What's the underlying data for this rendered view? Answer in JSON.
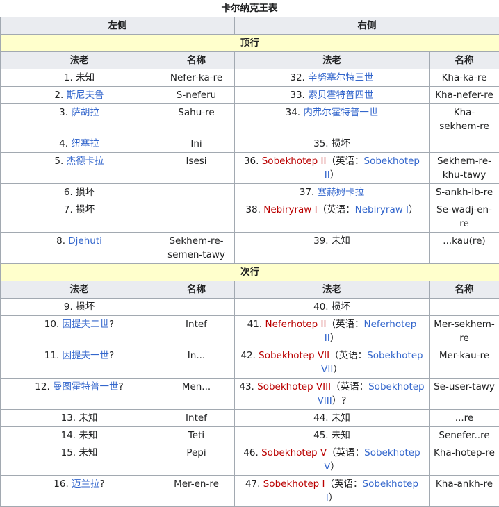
{
  "caption": "卡尔纳克王表",
  "sides": {
    "left": "左侧",
    "right": "右侧"
  },
  "col_headers": {
    "pharaoh": "法老",
    "name": "名称"
  },
  "sections": [
    {
      "title": "顶行",
      "rows": [
        {
          "left": [
            {
              "t": "1. 未知"
            }
          ],
          "left_name": "Nefer-ka-re",
          "right": [
            {
              "t": "32. "
            },
            {
              "t": "辛努塞尔特三世",
              "c": "lnk"
            }
          ],
          "right_name": "Kha-ka-re",
          "h": 25
        },
        {
          "left": [
            {
              "t": "2. "
            },
            {
              "t": "斯尼夫鲁",
              "c": "lnk"
            }
          ],
          "left_name": "S-neferu",
          "right": [
            {
              "t": "33. "
            },
            {
              "t": "索贝霍特普四世",
              "c": "lnk"
            }
          ],
          "right_name": "Kha-nefer-re",
          "h": 25
        },
        {
          "left": [
            {
              "t": "3. "
            },
            {
              "t": "萨胡拉",
              "c": "lnk"
            }
          ],
          "left_name": "Sahu-re",
          "right": [
            {
              "t": "34. "
            },
            {
              "t": "内弗尔霍特普一世",
              "c": "lnk"
            }
          ],
          "right_name": "Kha-sekhem-re",
          "h": 45
        },
        {
          "left": [
            {
              "t": "4. "
            },
            {
              "t": "纽塞拉",
              "c": "lnk"
            }
          ],
          "left_name": "Ini",
          "right": [
            {
              "t": "35. 损坏"
            }
          ],
          "right_name": "",
          "h": 25
        },
        {
          "left": [
            {
              "t": "5. "
            },
            {
              "t": "杰德卡拉",
              "c": "lnk"
            }
          ],
          "left_name": "Isesi",
          "right": [
            {
              "t": "36. "
            },
            {
              "t": "Sobekhotep II",
              "c": "red"
            },
            {
              "t": "（英语："
            },
            {
              "t": "Sobekhotep II",
              "c": "lnk"
            },
            {
              "t": "）"
            }
          ],
          "right_name": "Sekhem-re-khu-tawy",
          "h": 45
        },
        {
          "left": [
            {
              "t": "6. 损坏"
            }
          ],
          "left_name": "",
          "right": [
            {
              "t": "37. "
            },
            {
              "t": "塞赫姆卡拉",
              "c": "lnk"
            }
          ],
          "right_name": "S-ankh-ib-re",
          "h": 25
        },
        {
          "left": [
            {
              "t": "7. 损坏"
            }
          ],
          "left_name": "",
          "right": [
            {
              "t": "38. "
            },
            {
              "t": "Nebiryraw I",
              "c": "red"
            },
            {
              "t": "（英语："
            },
            {
              "t": "Nebiryraw I",
              "c": "lnk"
            },
            {
              "t": "）"
            }
          ],
          "right_name": "Se-wadj-en-re",
          "h": 45
        },
        {
          "left": [
            {
              "t": "8. "
            },
            {
              "t": "Djehuti",
              "c": "lnk"
            }
          ],
          "left_name": "Sekhem-re-semen-tawy",
          "right": [
            {
              "t": "39. 未知"
            }
          ],
          "right_name": "...kau(re)",
          "h": 45
        }
      ]
    },
    {
      "title": "次行",
      "rows": [
        {
          "left": [
            {
              "t": "9. 损坏"
            }
          ],
          "left_name": "",
          "right": [
            {
              "t": "40. 损坏"
            }
          ],
          "right_name": "",
          "h": 25
        },
        {
          "left": [
            {
              "t": "10. "
            },
            {
              "t": "因提夫二世",
              "c": "lnk"
            },
            {
              "t": "?"
            }
          ],
          "left_name": "Intef",
          "right": [
            {
              "t": "41. "
            },
            {
              "t": "Neferhotep II",
              "c": "red"
            },
            {
              "t": "（英语："
            },
            {
              "t": "Neferhotep II",
              "c": "lnk"
            },
            {
              "t": "）"
            }
          ],
          "right_name": "Mer-sekhem-re",
          "h": 45
        },
        {
          "left": [
            {
              "t": "11. "
            },
            {
              "t": "因提夫一世",
              "c": "lnk"
            },
            {
              "t": "?"
            }
          ],
          "left_name": "In...",
          "right": [
            {
              "t": "42. "
            },
            {
              "t": "Sobekhotep VII",
              "c": "red"
            },
            {
              "t": "（英语："
            },
            {
              "t": "Sobekhotep VII",
              "c": "lnk"
            },
            {
              "t": "）"
            }
          ],
          "right_name": "Mer-kau-re",
          "h": 45
        },
        {
          "left": [
            {
              "t": "12. "
            },
            {
              "t": "曼图霍特普一世",
              "c": "lnk"
            },
            {
              "t": "?"
            }
          ],
          "left_name": "Men...",
          "right": [
            {
              "t": "43. "
            },
            {
              "t": "Sobekhotep VIII",
              "c": "red"
            },
            {
              "t": "（英语："
            },
            {
              "t": "Sobekhotep VIII",
              "c": "lnk"
            },
            {
              "t": "）?"
            }
          ],
          "right_name": "Se-user-tawy",
          "h": 45
        },
        {
          "left": [
            {
              "t": "13. 未知"
            }
          ],
          "left_name": "Intef",
          "right": [
            {
              "t": "44. 未知"
            }
          ],
          "right_name": "...re",
          "h": 25
        },
        {
          "left": [
            {
              "t": "14. 未知"
            }
          ],
          "left_name": "Teti",
          "right": [
            {
              "t": "45. 未知"
            }
          ],
          "right_name": "Senefer..re",
          "h": 25
        },
        {
          "left": [
            {
              "t": "15. 未知"
            }
          ],
          "left_name": "Pepi",
          "right": [
            {
              "t": "46. "
            },
            {
              "t": "Sobekhotep V",
              "c": "red"
            },
            {
              "t": "（英语："
            },
            {
              "t": "Sobekhotep V",
              "c": "lnk"
            },
            {
              "t": "）"
            }
          ],
          "right_name": "Kha-hotep-re",
          "h": 45
        },
        {
          "left": [
            {
              "t": "16. "
            },
            {
              "t": "迈兰拉",
              "c": "lnk"
            },
            {
              "t": "?"
            }
          ],
          "left_name": "Mer-en-re",
          "right": [
            {
              "t": "47. "
            },
            {
              "t": "Sobekhotep I",
              "c": "red"
            },
            {
              "t": "（英语："
            },
            {
              "t": "Sobekhotep I",
              "c": "lnk"
            },
            {
              "t": "）"
            }
          ],
          "right_name": "Kha-ankh-re",
          "h": 45
        }
      ]
    }
  ]
}
